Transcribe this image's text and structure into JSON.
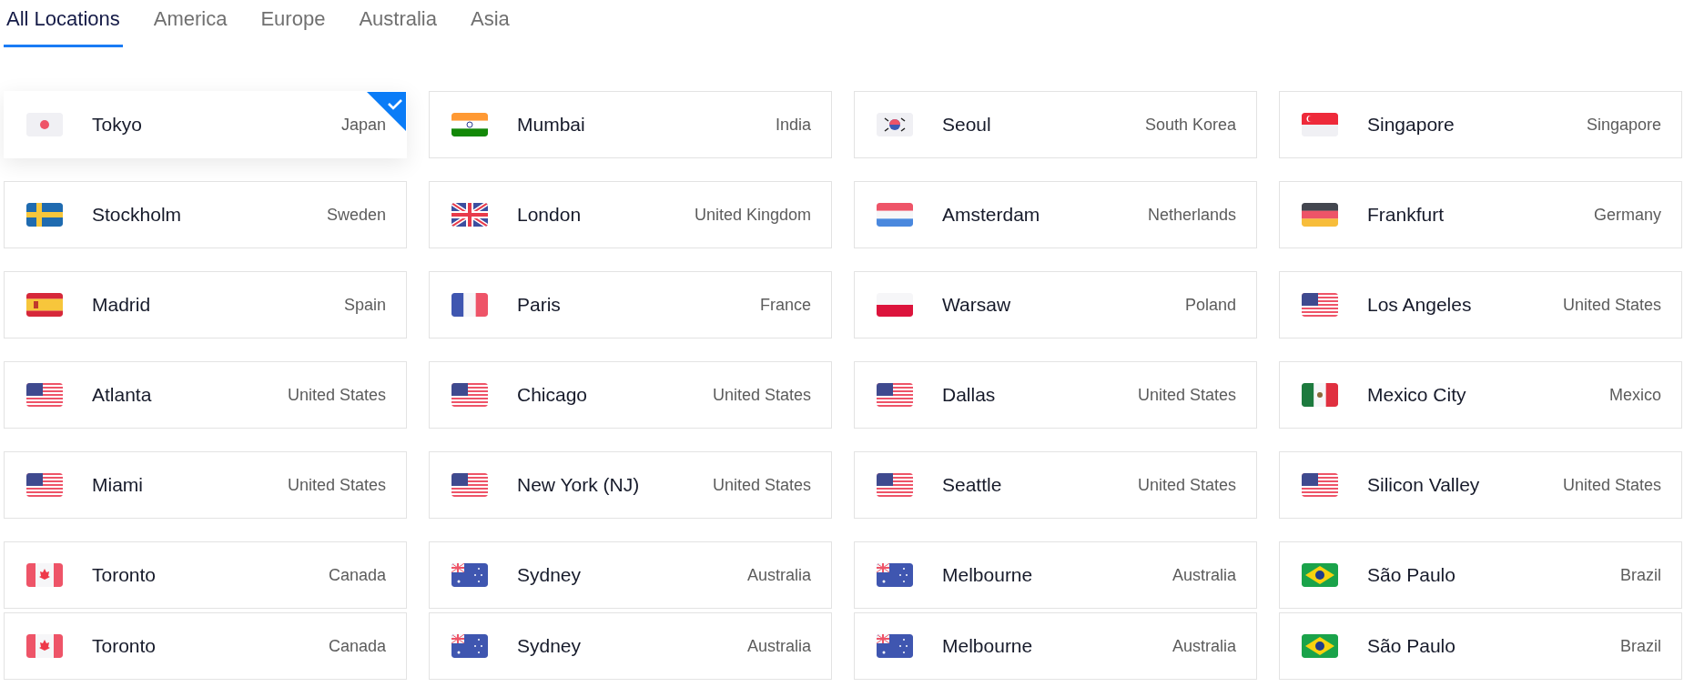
{
  "tabs": [
    {
      "label": "All Locations",
      "selected": true
    },
    {
      "label": "America",
      "selected": false
    },
    {
      "label": "Europe",
      "selected": false
    },
    {
      "label": "Australia",
      "selected": false
    },
    {
      "label": "Asia",
      "selected": false
    }
  ],
  "locations": [
    {
      "city": "Tokyo",
      "country": "Japan",
      "kind": "jp",
      "selected": true
    },
    {
      "city": "Mumbai",
      "country": "India",
      "kind": "in",
      "selected": false
    },
    {
      "city": "Seoul",
      "country": "South Korea",
      "kind": "kr",
      "selected": false
    },
    {
      "city": "Singapore",
      "country": "Singapore",
      "kind": "sg",
      "selected": false
    },
    {
      "city": "Stockholm",
      "country": "Sweden",
      "kind": "se",
      "selected": false
    },
    {
      "city": "London",
      "country": "United Kingdom",
      "kind": "gb",
      "selected": false
    },
    {
      "city": "Amsterdam",
      "country": "Netherlands",
      "kind": "nl",
      "selected": false
    },
    {
      "city": "Frankfurt",
      "country": "Germany",
      "kind": "de",
      "selected": false
    },
    {
      "city": "Madrid",
      "country": "Spain",
      "kind": "es",
      "selected": false
    },
    {
      "city": "Paris",
      "country": "France",
      "kind": "fr",
      "selected": false
    },
    {
      "city": "Warsaw",
      "country": "Poland",
      "kind": "pl",
      "selected": false
    },
    {
      "city": "Los Angeles",
      "country": "United States",
      "kind": "us",
      "selected": false
    },
    {
      "city": "Atlanta",
      "country": "United States",
      "kind": "us",
      "selected": false
    },
    {
      "city": "Chicago",
      "country": "United States",
      "kind": "us",
      "selected": false
    },
    {
      "city": "Dallas",
      "country": "United States",
      "kind": "us",
      "selected": false
    },
    {
      "city": "Mexico City",
      "country": "Mexico",
      "kind": "mx",
      "selected": false
    },
    {
      "city": "Miami",
      "country": "United States",
      "kind": "us",
      "selected": false
    },
    {
      "city": "New York (NJ)",
      "country": "United States",
      "kind": "us",
      "selected": false
    },
    {
      "city": "Seattle",
      "country": "United States",
      "kind": "us",
      "selected": false
    },
    {
      "city": "Silicon Valley",
      "country": "United States",
      "kind": "us",
      "selected": false
    },
    {
      "city": "Toronto",
      "country": "Canada",
      "kind": "ca",
      "selected": false
    },
    {
      "city": "Sydney",
      "country": "Australia",
      "kind": "au",
      "selected": false
    },
    {
      "city": "Melbourne",
      "country": "Australia",
      "kind": "au",
      "selected": false
    },
    {
      "city": "São Paulo",
      "country": "Brazil",
      "kind": "br",
      "selected": false
    }
  ],
  "locations_next_row": [
    {
      "city": "Toronto",
      "country": "Canada",
      "kind": "ca",
      "selected": false
    },
    {
      "city": "Sydney",
      "country": "Australia",
      "kind": "au",
      "selected": false
    },
    {
      "city": "Melbourne",
      "country": "Australia",
      "kind": "au",
      "selected": false
    },
    {
      "city": "São Paulo",
      "country": "Brazil",
      "kind": "br",
      "selected": false
    }
  ]
}
